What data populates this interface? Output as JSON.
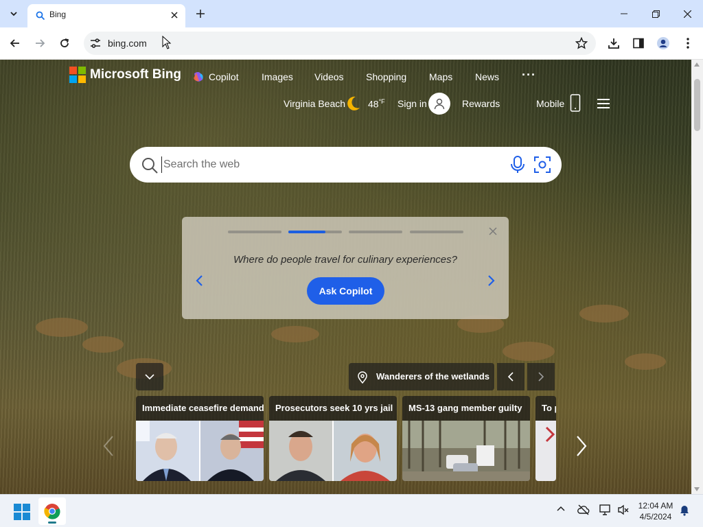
{
  "browser": {
    "tab_title": "Bing",
    "url": "bing.com"
  },
  "bing": {
    "brand": "Microsoft Bing",
    "nav": [
      "Copilot",
      "Images",
      "Videos",
      "Shopping",
      "Maps",
      "News"
    ],
    "more": "···",
    "location": "Virginia Beach",
    "temperature": "48",
    "temp_unit": "°F",
    "sign_in": "Sign in",
    "rewards": "Rewards",
    "mobile": "Mobile",
    "search_placeholder": "Search the web",
    "promo": {
      "question": "Where do people travel for culinary experiences?",
      "button": "Ask Copilot",
      "progress_segments": 4,
      "active_segment": 2
    },
    "image_caption": "Wanderers of the wetlands",
    "news_cards": [
      {
        "title": "Immediate ceasefire demand"
      },
      {
        "title": "Prosecutors seek 10 yrs jail"
      },
      {
        "title": "MS-13 gang member guilty"
      },
      {
        "title": "To p"
      }
    ]
  },
  "taskbar": {
    "time": "12:04 AM",
    "date": "4/5/2024"
  },
  "colors": {
    "accent": "#1f5fe8",
    "tab_strip": "#d3e3fd"
  }
}
